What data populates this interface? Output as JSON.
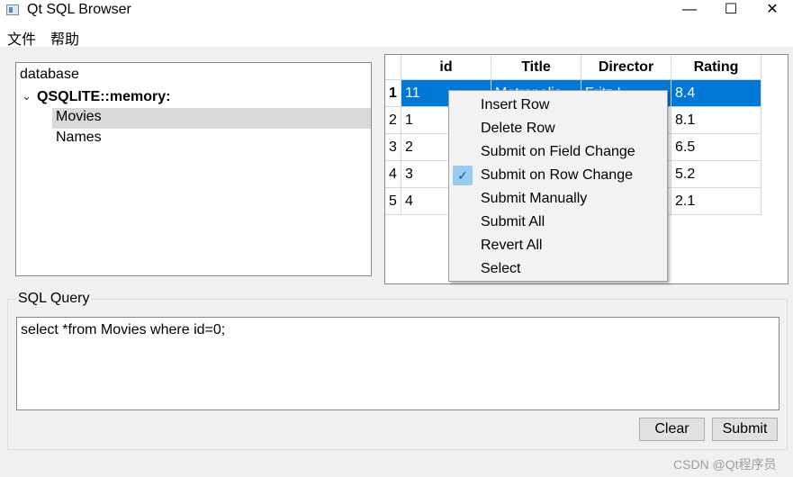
{
  "window": {
    "title": "Qt SQL Browser",
    "controls": {
      "minimize": "—",
      "maximize": "☐",
      "close": "✕"
    }
  },
  "menubar": {
    "items": [
      "文件",
      "帮助"
    ]
  },
  "tree": {
    "header": "database",
    "connection": "QSQLITE::memory:",
    "expand_icon": "chevron-down",
    "tables": [
      "Movies",
      "Names"
    ],
    "selected": "Movies"
  },
  "table": {
    "columns": [
      "id",
      "Title",
      "Director",
      "Rating"
    ],
    "row_headers": [
      "1",
      "2",
      "3",
      "4",
      "5"
    ],
    "rows": [
      [
        "11",
        "",
        "",
        "8.4"
      ],
      [
        "1",
        "",
        "",
        "8.1"
      ],
      [
        "2",
        "",
        "",
        "6.5"
      ],
      [
        "3",
        "",
        "",
        "5.2"
      ],
      [
        "4",
        "",
        "",
        "2.1"
      ]
    ],
    "partial_visible": [
      "Metropolis",
      "Fritz L"
    ],
    "selected_row": "1",
    "selection_color": "#0078d7"
  },
  "context_menu": {
    "items": [
      {
        "label": "Insert Row",
        "mnemonic": "I",
        "checked": false
      },
      {
        "label": "Delete Row",
        "mnemonic": "D",
        "checked": false
      },
      {
        "label": "Submit on Field Change",
        "mnemonic": "F",
        "checked": false
      },
      {
        "label": "Submit on Row Change",
        "mnemonic": "R",
        "checked": true
      },
      {
        "label": "Submit Manually",
        "mnemonic": "M",
        "checked": false
      },
      {
        "label": "Submit All",
        "mnemonic": "S",
        "checked": false
      },
      {
        "label": "Revert All",
        "mnemonic": "R",
        "checked": false
      },
      {
        "label": "Select",
        "mnemonic": "e",
        "checked": false
      }
    ],
    "check_icon": "checkmark"
  },
  "query": {
    "group_label": "SQL Query",
    "text": "select *from Movies where id=0;",
    "clear_label": "Clear",
    "submit_label": "Submit"
  },
  "watermark": "CSDN @Qt程序员"
}
